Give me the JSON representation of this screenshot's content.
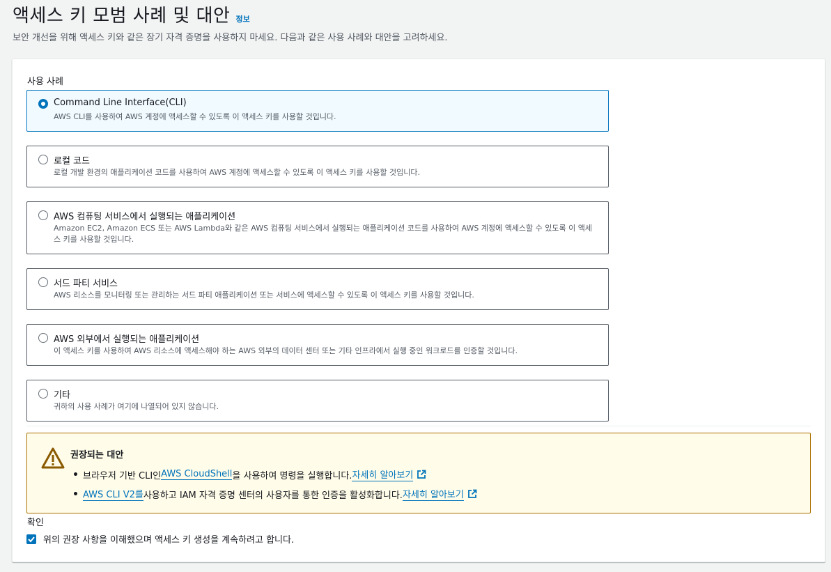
{
  "header": {
    "title": "액세스 키 모범 사례 및 대안",
    "info_link": "정보",
    "description": "보안 개선을 위해 액세스 키와 같은 장기 자격 증명을 사용하지 마세요. 다음과 같은 사용 사례와 대안을 고려하세요."
  },
  "use_cases": {
    "label": "사용 사례",
    "selected_index": 0,
    "options": [
      {
        "title": "Command Line Interface(CLI)",
        "description": "AWS CLI를 사용하여 AWS 계정에 액세스할 수 있도록 이 액세스 키를 사용할 것입니다."
      },
      {
        "title": "로컬 코드",
        "description": "로컬 개발 환경의 애플리케이션 코드를 사용하여 AWS 계정에 액세스할 수 있도록 이 액세스 키를 사용할 것입니다."
      },
      {
        "title": "AWS 컴퓨팅 서비스에서 실행되는 애플리케이션",
        "description": "Amazon EC2, Amazon ECS 또는 AWS Lambda와 같은 AWS 컴퓨팅 서비스에서 실행되는 애플리케이션 코드를 사용하여 AWS 계정에 액세스할 수 있도록 이 액세스 키를 사용할 것입니다."
      },
      {
        "title": "서드 파티 서비스",
        "description": "AWS 리소스를 모니터링 또는 관리하는 서드 파티 애플리케이션 또는 서비스에 액세스할 수 있도록 이 액세스 키를 사용할 것입니다."
      },
      {
        "title": "AWS 외부에서 실행되는 애플리케이션",
        "description": "이 액세스 키를 사용하여 AWS 리소스에 액세스해야 하는 AWS 외부의 데이터 센터 또는 기타 인프라에서 실행 중인 워크로드를 인증할 것입니다."
      },
      {
        "title": "기타",
        "description": "귀하의 사용 사례가 여기에 나열되어 있지 않습니다."
      }
    ]
  },
  "alert": {
    "title": "권장되는 대안",
    "items": [
      {
        "prefix": "브라우저 기반 CLI인 ",
        "link": "AWS CloudShell",
        "middle": "을 사용하여 명령을 실행합니다. ",
        "learn_more": "자세히 알아보기"
      },
      {
        "prefix": "",
        "link": "AWS CLI V2를",
        "middle": " 사용하고 IAM 자격 증명 센터의 사용자를 통한 인증을 활성화합니다. ",
        "learn_more": "자세히 알아보기"
      }
    ]
  },
  "confirmation": {
    "label": "확인",
    "checkbox_label": "위의 권장 사항을 이해했으며 액세스 키 생성을 계속하려고 합니다.",
    "checked": true
  },
  "colors": {
    "accent": "#0073bb",
    "warning_border": "#ac7100",
    "warning_bg": "#fffce9"
  }
}
